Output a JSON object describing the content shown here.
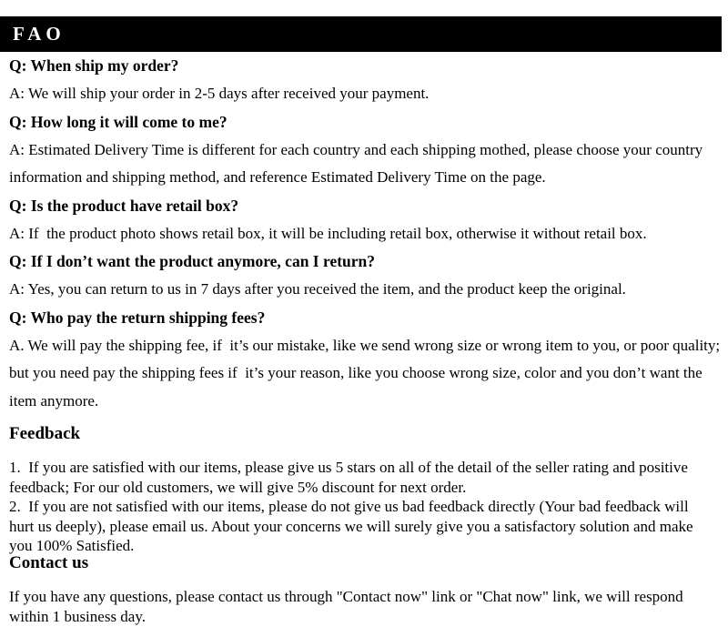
{
  "header": {
    "title": "FAO",
    "background_color": "#000000",
    "text_color": "#ffffff"
  },
  "page": {
    "background_color": "#ffffff",
    "text_color": "#000000"
  },
  "faq": {
    "items": [
      {
        "question": "Q: When ship my order?",
        "answer": "A: We will ship your order in 2-5 days after received your payment."
      },
      {
        "question": "Q: How long it will come to me?",
        "answer": "A: Estimated Delivery Time is different for each country and each shipping mothed, please choose your country information and shipping method, and reference Estimated Delivery Time on the page."
      },
      {
        "question": "Q: Is the product have retail box?",
        "answer": "A: If  the product photo shows retail box, it will be including retail box, otherwise it without retail box."
      },
      {
        "question": "Q: If I don’t want the product anymore, can I return?",
        "answer": "A: Yes, you can return to us in 7 days after you received the item, and the product keep the original."
      },
      {
        "question": "Q: Who pay the return shipping fees?",
        "answer": "A. We will pay the shipping fee, if  it’s our mistake, like we send wrong size or wrong item to you, or poor quality; but you need pay the shipping fees if  it’s your reason, like you choose wrong size, color and you don’t want the item anymore."
      }
    ]
  },
  "feedback": {
    "heading": "Feedback",
    "items": [
      "1.  If you are satisfied with our items, please give us 5 stars on all of the detail of the seller rating and positive feedback; For our old customers, we will give 5% discount for next order.",
      "2.  If you are not satisfied with our items, please do not give us bad feedback directly (Your bad feedback will hurt us deeply), please email us. About your concerns we will surely give you a satisfactory solution and make you 100% Satisfied."
    ]
  },
  "contact": {
    "heading": "Contact us",
    "paragraph": "If you have any questions, please contact us through \"Contact now\" link or \"Chat now\" link, we will respond within 1 business day."
  }
}
